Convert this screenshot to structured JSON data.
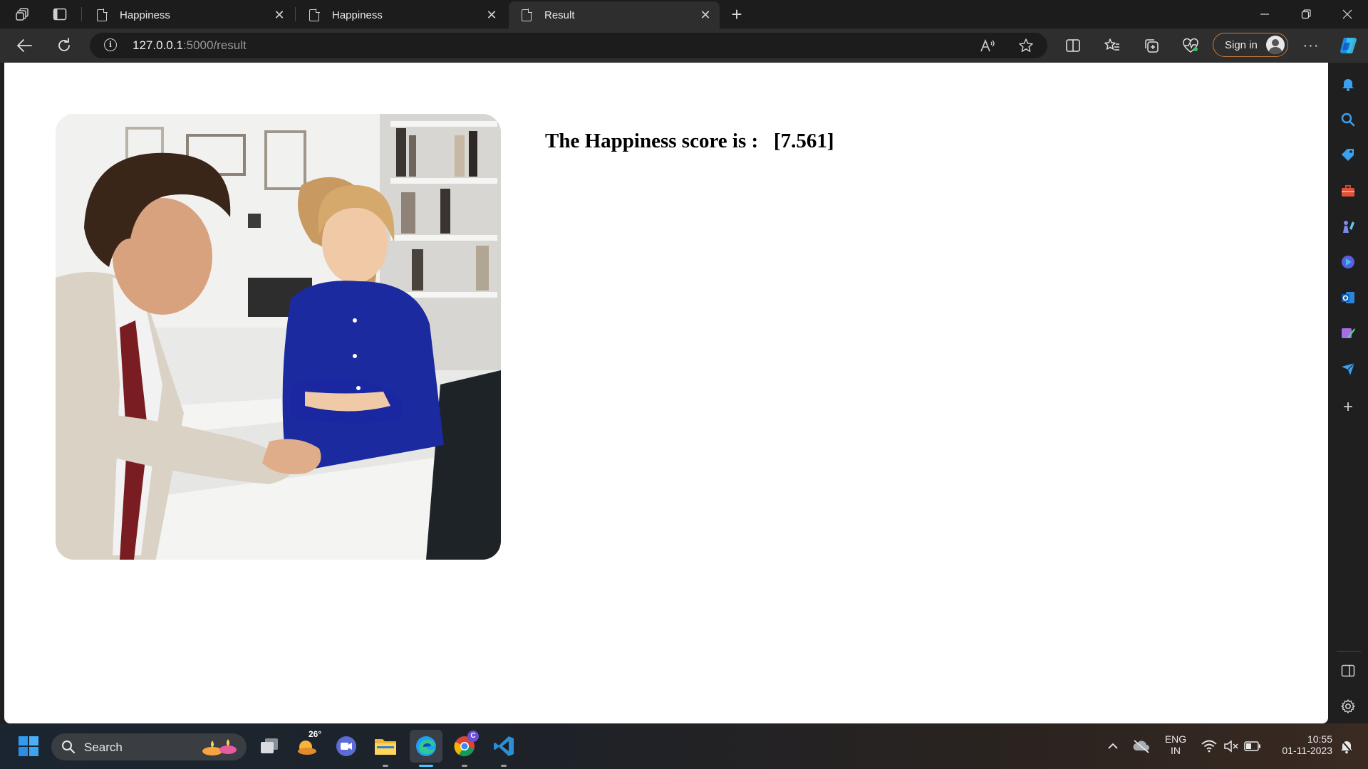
{
  "browser": {
    "tabs": [
      {
        "title": "Happiness",
        "active": false
      },
      {
        "title": "Happiness",
        "active": false
      },
      {
        "title": "Result",
        "active": true
      }
    ],
    "url_host": "127.0.0.1",
    "url_path": ":5000/result",
    "signin_label": "Sign in"
  },
  "page": {
    "score_label": "The Happiness score is :   [7.561]"
  },
  "taskbar": {
    "search_label": "Search",
    "weather_temp": "26°",
    "chrome_badge": "C",
    "lang_top": "ENG",
    "lang_bottom": "IN",
    "time": "10:55",
    "date": "01-11-2023"
  },
  "colors": {
    "signin_border": "#c77a3a",
    "edge_accent": "#1ea1f2",
    "vscode_blue": "#2a8fd6",
    "windows_blue": "#2f9cf3",
    "score_text": "#000000"
  }
}
